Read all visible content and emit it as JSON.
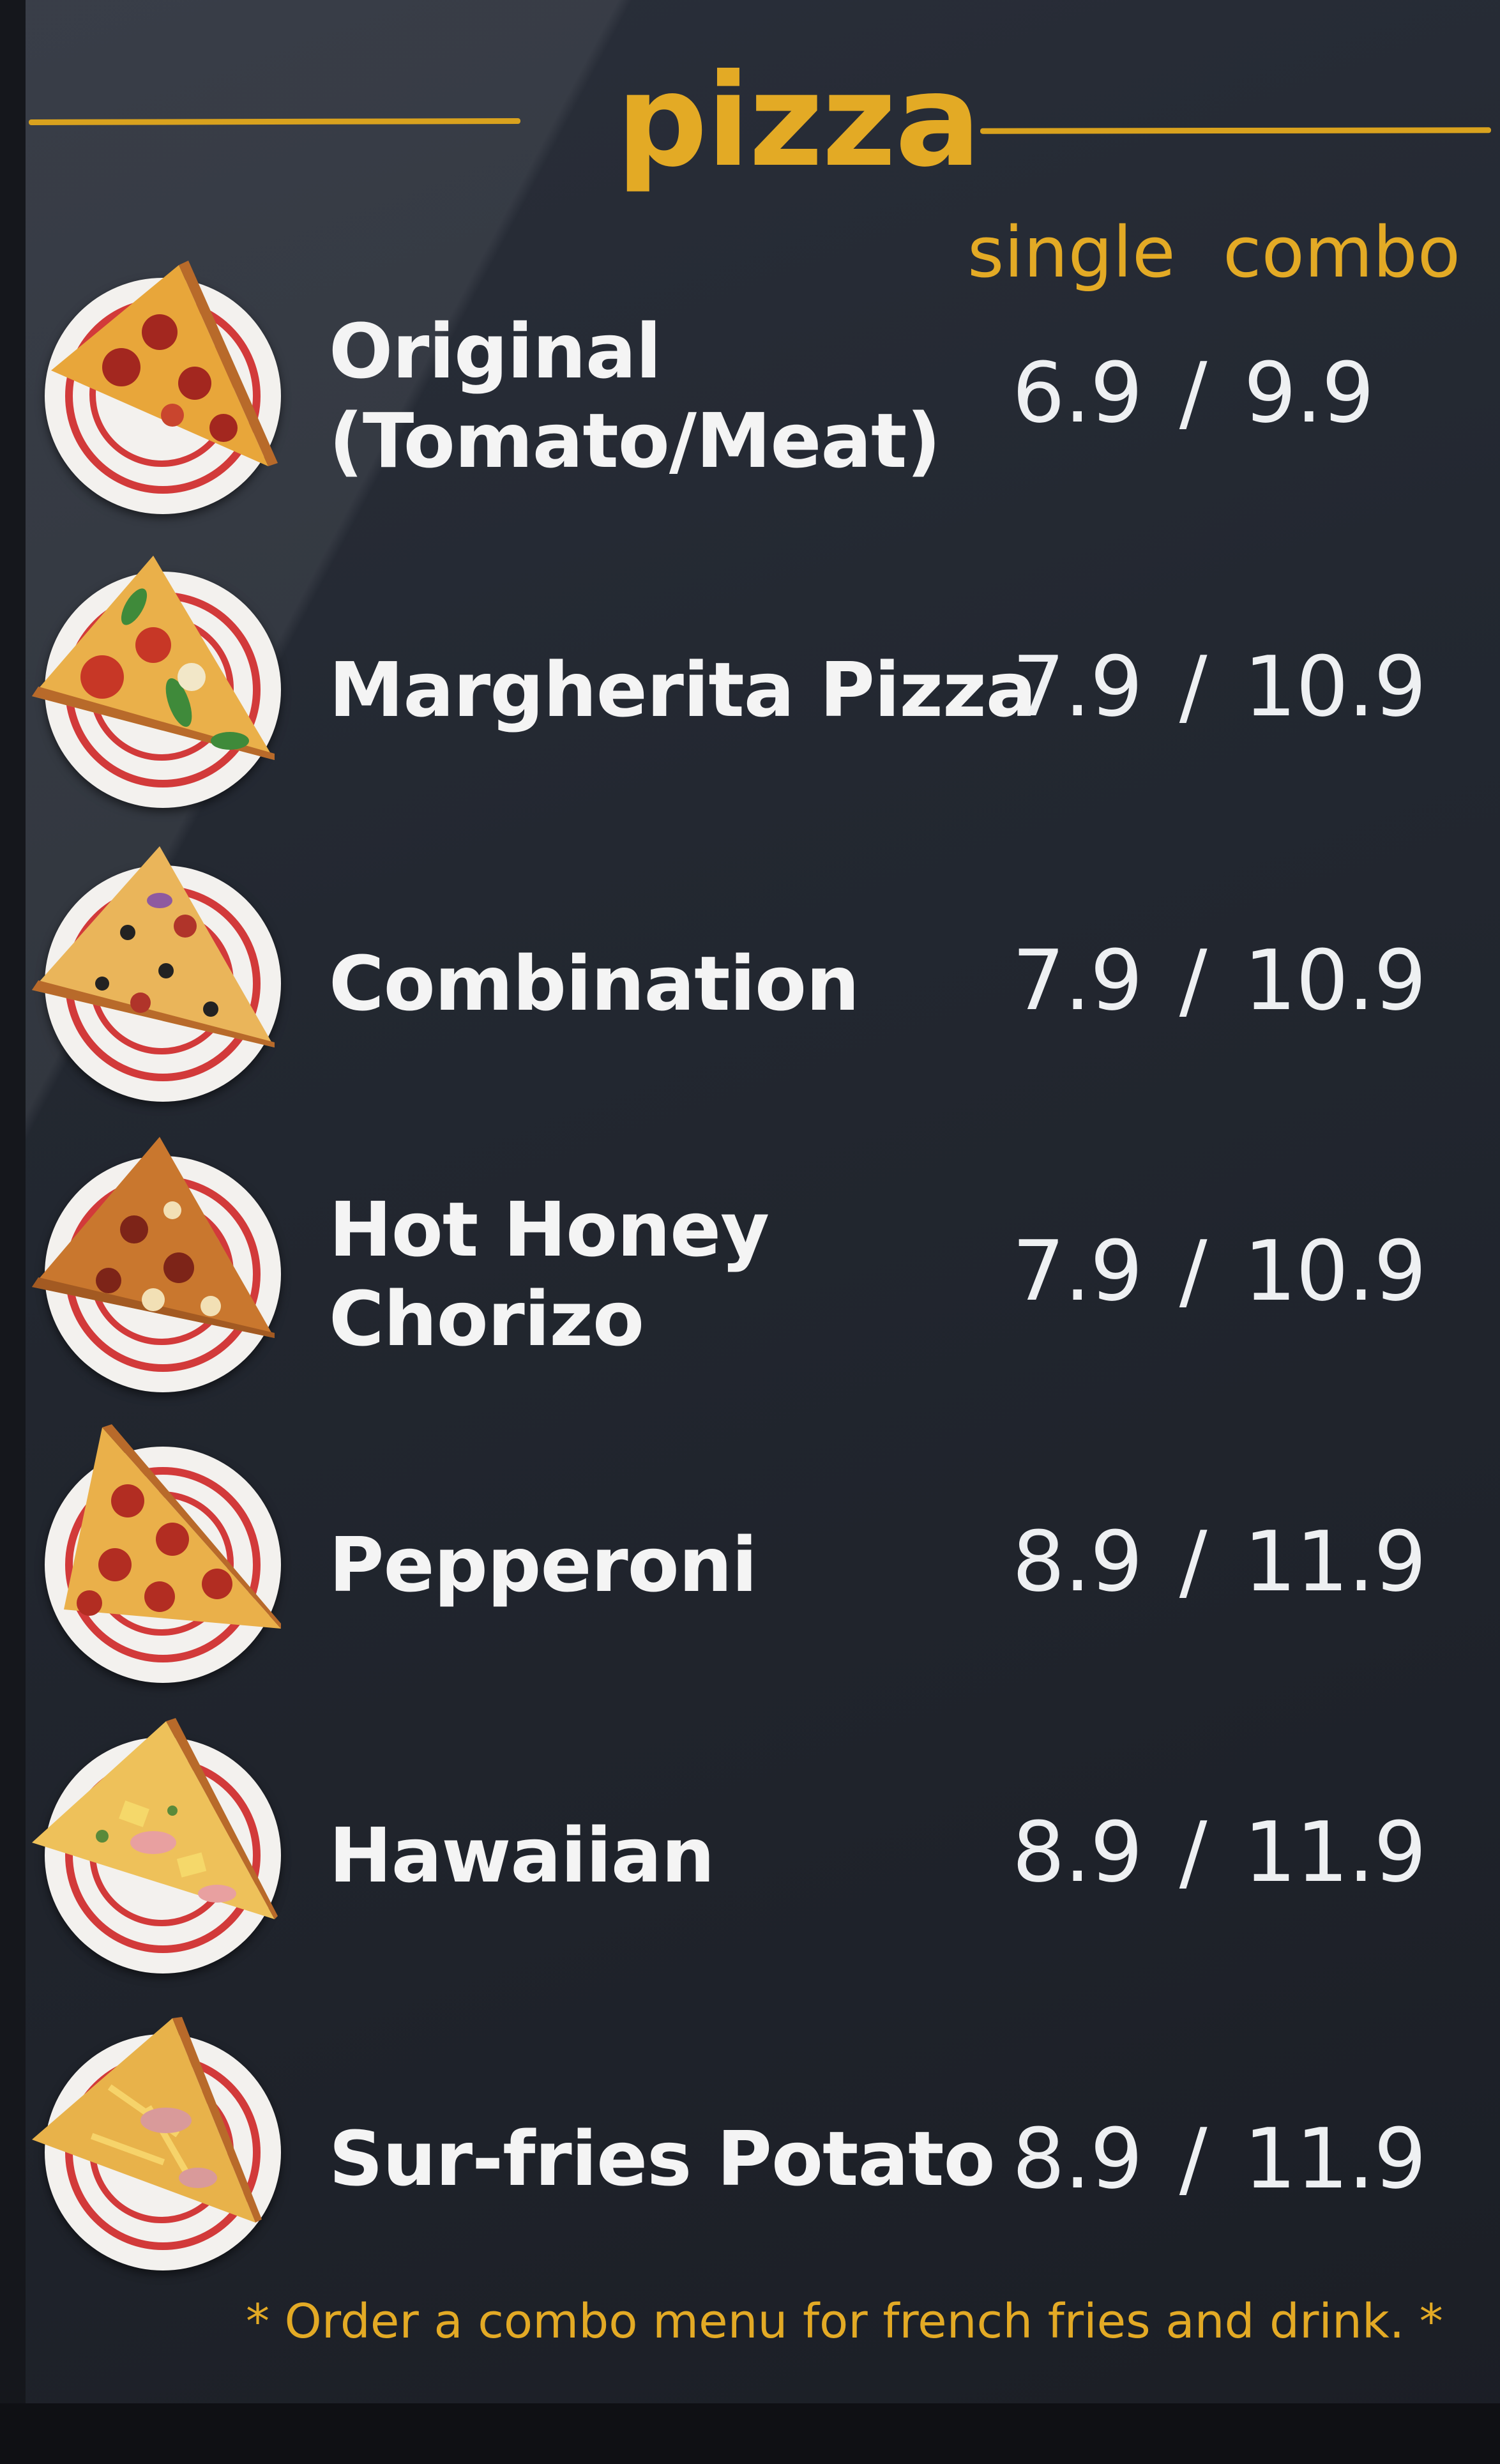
{
  "title": "pizza",
  "columns": {
    "single": "single",
    "combo": "combo"
  },
  "price_separator": "/",
  "items": [
    {
      "name_line1": "Original",
      "name_line2": "(Tomato/Meat)",
      "single": "6.9",
      "combo": "9.9"
    },
    {
      "name_line1": "Margherita Pizza",
      "name_line2": "",
      "single": "7.9",
      "combo": "10.9"
    },
    {
      "name_line1": "Combination",
      "name_line2": "",
      "single": "7.9",
      "combo": "10.9"
    },
    {
      "name_line1": "Hot Honey",
      "name_line2": "Chorizo",
      "single": "7.9",
      "combo": "10.9"
    },
    {
      "name_line1": "Pepperoni",
      "name_line2": "",
      "single": "8.9",
      "combo": "11.9"
    },
    {
      "name_line1": "Hawaiian",
      "name_line2": "",
      "single": "8.9",
      "combo": "11.9"
    },
    {
      "name_line1": "Sur-fries Potato",
      "name_line2": "",
      "single": "8.9",
      "combo": "11.9"
    }
  ],
  "footnote": "* Order a combo menu for french fries and drink. *",
  "colors": {
    "accent": "#e3aa25",
    "board": "#1f232b",
    "plate_red": "#d23a3a",
    "text": "#f4f4f4"
  }
}
